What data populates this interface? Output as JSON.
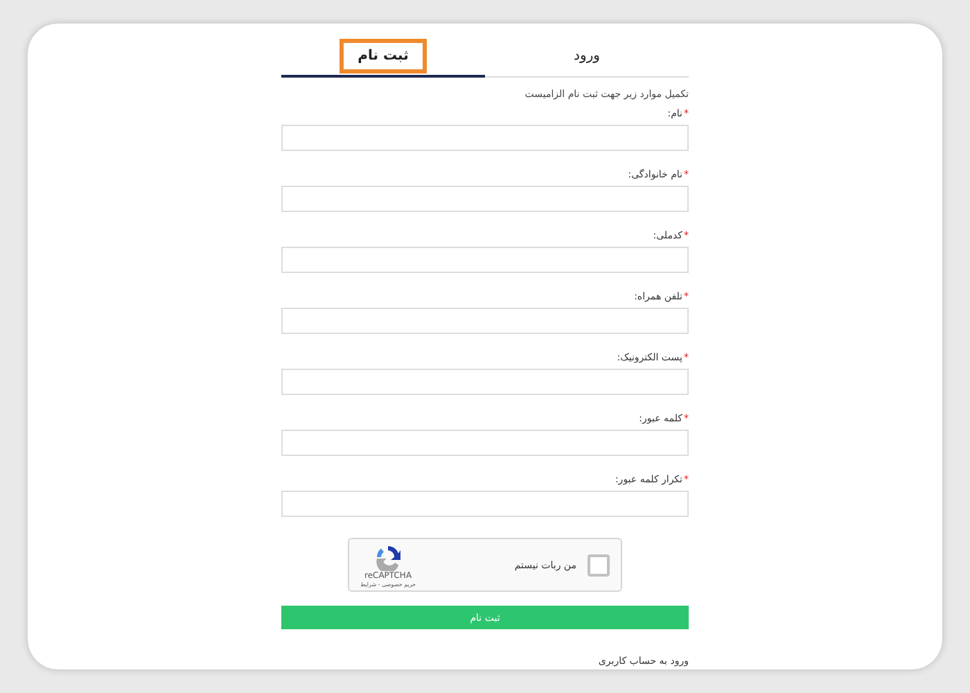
{
  "tabs": [
    {
      "label": "ورود",
      "selected": false,
      "highlighted": false
    },
    {
      "label": "ثبت نام",
      "selected": true,
      "highlighted": true
    }
  ],
  "intro": "تکمیل موارد زیر جهت ثبت نام الزامیست",
  "fields": [
    {
      "label": "نام:",
      "required_mark": "*"
    },
    {
      "label": "نام خانوادگی:",
      "required_mark": "*"
    },
    {
      "label": "کدملی:",
      "required_mark": "*"
    },
    {
      "label": "تلفن همراه:",
      "required_mark": "*"
    },
    {
      "label": "پست الکترونیک:",
      "required_mark": "*"
    },
    {
      "label": "کلمه عبور:",
      "required_mark": "*"
    },
    {
      "label": "تکرار کلمه عبور:",
      "required_mark": "*"
    }
  ],
  "captcha": {
    "label": "من ربات نیستم",
    "checked": false,
    "brand": "reCAPTCHA",
    "links": "حریم خصوصی - شرایط"
  },
  "submit": "ثبت نام",
  "login_link": "ورود به حساب کاربری"
}
